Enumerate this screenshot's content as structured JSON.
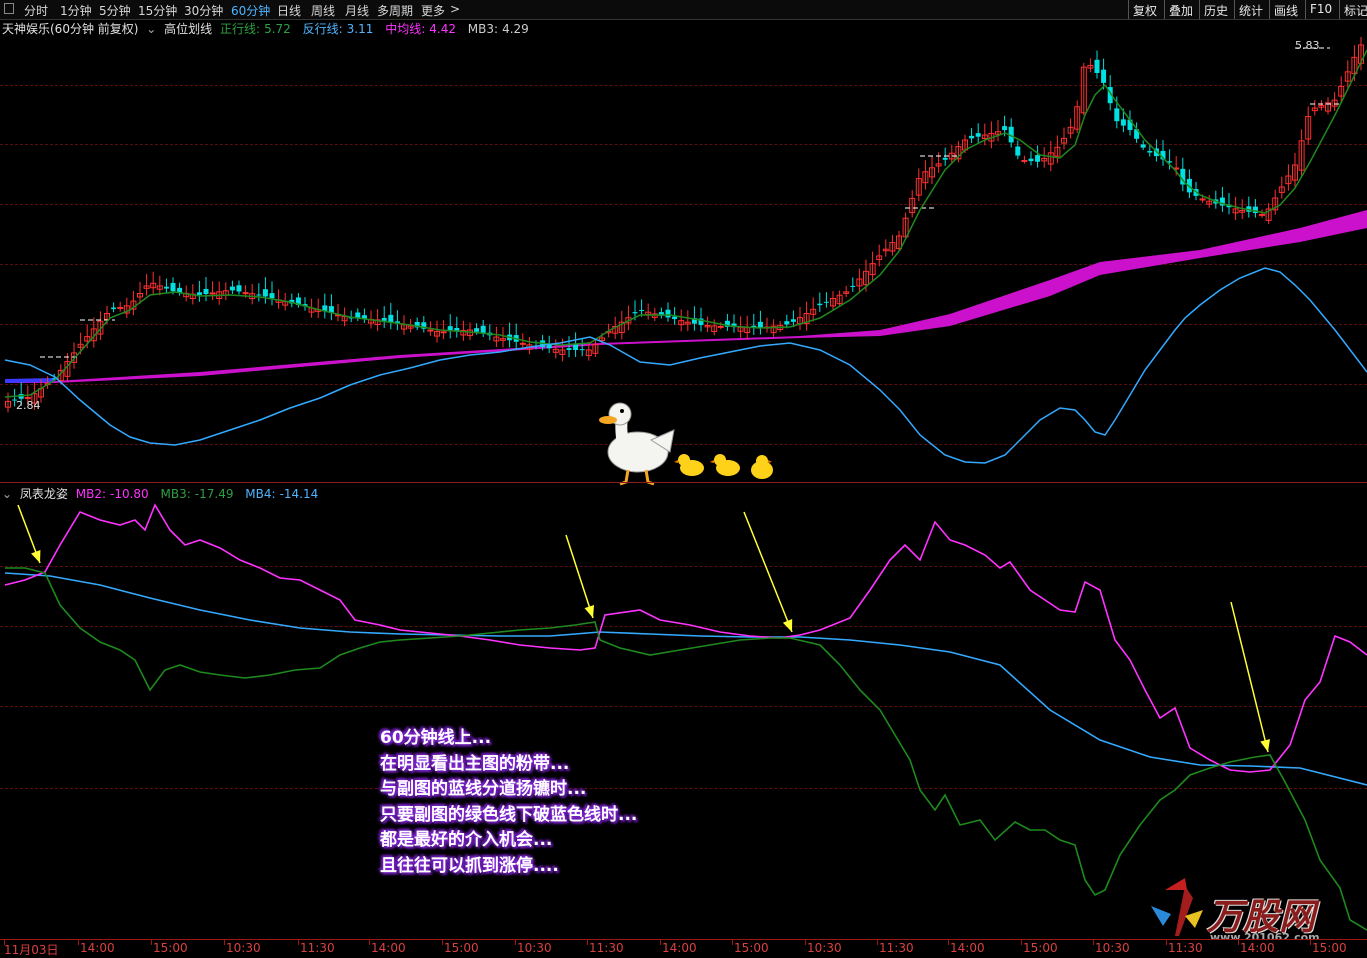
{
  "toolbar": {
    "periods": [
      "分时",
      "1分钟",
      "5分钟",
      "15分钟",
      "30分钟",
      "60分钟",
      "日线",
      "周线",
      "月线",
      "多周期",
      "更多"
    ],
    "active_period": "60分钟",
    "right_buttons": [
      "复权",
      "叠加",
      "历史",
      "统计",
      "画线",
      "F10",
      "标记"
    ]
  },
  "main_pane": {
    "stock_label": "天神娱乐(60分钟 前复权)",
    "indicator_name": "高位划线",
    "legend": [
      {
        "label": "正行线:",
        "value": "5.72",
        "color": "#2ea043"
      },
      {
        "label": "反行线:",
        "value": "3.11",
        "color": "#4fb5ff"
      },
      {
        "label": "中均线:",
        "value": "4.42",
        "color": "#ff33ff"
      },
      {
        "label": "MB3:",
        "value": "4.29",
        "color": "#cccccc"
      }
    ],
    "high_label": "5.83",
    "low_label": "2.84"
  },
  "sub_pane": {
    "indicator_name": "凤表龙姿",
    "legend": [
      {
        "label": "MB2:",
        "value": "-10.80",
        "color": "#ff33ff"
      },
      {
        "label": "MB3:",
        "value": "-17.49",
        "color": "#2ea043"
      },
      {
        "label": "MB4:",
        "value": "-14.14",
        "color": "#4fb5ff"
      }
    ]
  },
  "annotation": {
    "lines": [
      "60分钟线上...",
      "在明显看出主图的粉带...",
      "与副图的蓝线分道扬镳时...",
      "只要副图的绿色线下破蓝色线时...",
      "都是最好的介入机会...",
      "且往往可以抓到涨停...."
    ]
  },
  "time_axis": [
    "11月03日",
    "14:00",
    "15:00",
    "10:30",
    "11:30",
    "14:00",
    "15:00",
    "10:30",
    "11:30",
    "14:00",
    "15:00",
    "10:30",
    "11:30",
    "14:00",
    "15:00",
    "10:30",
    "11:30",
    "14:00",
    "15:00"
  ],
  "watermark": {
    "text": "万股网",
    "url": "www.201062.com"
  },
  "colors": {
    "up": "#ff3030",
    "down": "#00e0e0",
    "green": "#1e8a1e",
    "blue": "#33aaff",
    "pink": "#ff33ff",
    "magenta_band": "#cc11cc",
    "arrow": "#ffff33",
    "grid": "#5a0f0f"
  }
}
